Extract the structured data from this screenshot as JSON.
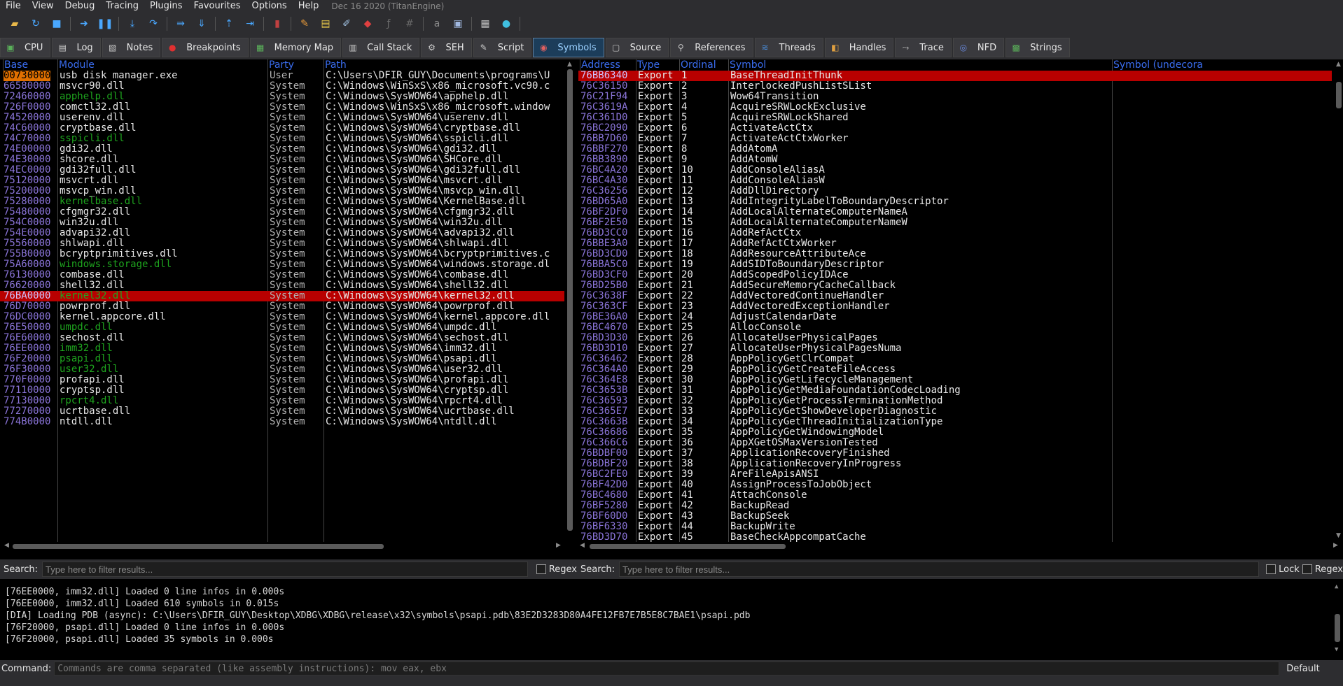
{
  "menu": {
    "items": [
      "File",
      "View",
      "Debug",
      "Tracing",
      "Plugins",
      "Favourites",
      "Options",
      "Help"
    ],
    "build_title": "Dec 16 2020 (TitanEngine)"
  },
  "tabs": [
    {
      "label": "CPU",
      "icon": "cpu-icon"
    },
    {
      "label": "Log",
      "icon": "log-icon"
    },
    {
      "label": "Notes",
      "icon": "notes-icon"
    },
    {
      "label": "Breakpoints",
      "icon": "breakpoint-icon"
    },
    {
      "label": "Memory Map",
      "icon": "memory-map-icon"
    },
    {
      "label": "Call Stack",
      "icon": "call-stack-icon"
    },
    {
      "label": "SEH",
      "icon": "seh-icon"
    },
    {
      "label": "Script",
      "icon": "script-icon"
    },
    {
      "label": "Symbols",
      "icon": "symbols-icon",
      "active": true
    },
    {
      "label": "Source",
      "icon": "source-icon"
    },
    {
      "label": "References",
      "icon": "references-icon"
    },
    {
      "label": "Threads",
      "icon": "threads-icon"
    },
    {
      "label": "Handles",
      "icon": "handles-icon"
    },
    {
      "label": "Trace",
      "icon": "trace-icon"
    },
    {
      "label": "NFD",
      "icon": "nfd-icon"
    },
    {
      "label": "Strings",
      "icon": "strings-icon"
    }
  ],
  "modules": {
    "headers": {
      "base": "Base",
      "module": "Module",
      "party": "Party",
      "path": "Path"
    },
    "rows": [
      {
        "base": "00730000",
        "module": "usb disk manager.exe",
        "party": "User",
        "path": "C:\\Users\\DFIR_GUY\\Documents\\programs\\U",
        "color": "white",
        "highlight_base": true
      },
      {
        "base": "66580000",
        "module": "msvcr90.dll",
        "party": "System",
        "path": "C:\\Windows\\WinSxS\\x86_microsoft.vc90.c",
        "color": "white"
      },
      {
        "base": "72460000",
        "module": "apphelp.dll",
        "party": "System",
        "path": "C:\\Windows\\SysWOW64\\apphelp.dll",
        "color": "green"
      },
      {
        "base": "726F0000",
        "module": "comctl32.dll",
        "party": "System",
        "path": "C:\\Windows\\WinSxS\\x86_microsoft.window",
        "color": "white"
      },
      {
        "base": "74520000",
        "module": "userenv.dll",
        "party": "System",
        "path": "C:\\Windows\\SysWOW64\\userenv.dll",
        "color": "white"
      },
      {
        "base": "74C60000",
        "module": "cryptbase.dll",
        "party": "System",
        "path": "C:\\Windows\\SysWOW64\\cryptbase.dll",
        "color": "white"
      },
      {
        "base": "74C70000",
        "module": "sspicli.dll",
        "party": "System",
        "path": "C:\\Windows\\SysWOW64\\sspicli.dll",
        "color": "green"
      },
      {
        "base": "74E00000",
        "module": "gdi32.dll",
        "party": "System",
        "path": "C:\\Windows\\SysWOW64\\gdi32.dll",
        "color": "white"
      },
      {
        "base": "74E30000",
        "module": "shcore.dll",
        "party": "System",
        "path": "C:\\Windows\\SysWOW64\\SHCore.dll",
        "color": "white"
      },
      {
        "base": "74EC0000",
        "module": "gdi32full.dll",
        "party": "System",
        "path": "C:\\Windows\\SysWOW64\\gdi32full.dll",
        "color": "white"
      },
      {
        "base": "75120000",
        "module": "msvcrt.dll",
        "party": "System",
        "path": "C:\\Windows\\SysWOW64\\msvcrt.dll",
        "color": "white"
      },
      {
        "base": "75200000",
        "module": "msvcp_win.dll",
        "party": "System",
        "path": "C:\\Windows\\SysWOW64\\msvcp_win.dll",
        "color": "white"
      },
      {
        "base": "75280000",
        "module": "kernelbase.dll",
        "party": "System",
        "path": "C:\\Windows\\SysWOW64\\KernelBase.dll",
        "color": "green"
      },
      {
        "base": "75480000",
        "module": "cfgmgr32.dll",
        "party": "System",
        "path": "C:\\Windows\\SysWOW64\\cfgmgr32.dll",
        "color": "white"
      },
      {
        "base": "754C0000",
        "module": "win32u.dll",
        "party": "System",
        "path": "C:\\Windows\\SysWOW64\\win32u.dll",
        "color": "white"
      },
      {
        "base": "754E0000",
        "module": "advapi32.dll",
        "party": "System",
        "path": "C:\\Windows\\SysWOW64\\advapi32.dll",
        "color": "white"
      },
      {
        "base": "75560000",
        "module": "shlwapi.dll",
        "party": "System",
        "path": "C:\\Windows\\SysWOW64\\shlwapi.dll",
        "color": "white"
      },
      {
        "base": "755B0000",
        "module": "bcryptprimitives.dll",
        "party": "System",
        "path": "C:\\Windows\\SysWOW64\\bcryptprimitives.c",
        "color": "white"
      },
      {
        "base": "75A60000",
        "module": "windows.storage.dll",
        "party": "System",
        "path": "C:\\Windows\\SysWOW64\\windows.storage.dl",
        "color": "green"
      },
      {
        "base": "76130000",
        "module": "combase.dll",
        "party": "System",
        "path": "C:\\Windows\\SysWOW64\\combase.dll",
        "color": "white"
      },
      {
        "base": "76620000",
        "module": "shell32.dll",
        "party": "System",
        "path": "C:\\Windows\\SysWOW64\\shell32.dll",
        "color": "white"
      },
      {
        "base": "76BA0000",
        "module": "kernel32.dll",
        "party": "System",
        "path": "C:\\Windows\\SysWOW64\\kernel32.dll",
        "color": "green",
        "selected": true
      },
      {
        "base": "76D70000",
        "module": "powrprof.dll",
        "party": "System",
        "path": "C:\\Windows\\SysWOW64\\powrprof.dll",
        "color": "white"
      },
      {
        "base": "76DC0000",
        "module": "kernel.appcore.dll",
        "party": "System",
        "path": "C:\\Windows\\SysWOW64\\kernel.appcore.dll",
        "color": "white"
      },
      {
        "base": "76E50000",
        "module": "umpdc.dll",
        "party": "System",
        "path": "C:\\Windows\\SysWOW64\\umpdc.dll",
        "color": "green"
      },
      {
        "base": "76E60000",
        "module": "sechost.dll",
        "party": "System",
        "path": "C:\\Windows\\SysWOW64\\sechost.dll",
        "color": "white"
      },
      {
        "base": "76EE0000",
        "module": "imm32.dll",
        "party": "System",
        "path": "C:\\Windows\\SysWOW64\\imm32.dll",
        "color": "green"
      },
      {
        "base": "76F20000",
        "module": "psapi.dll",
        "party": "System",
        "path": "C:\\Windows\\SysWOW64\\psapi.dll",
        "color": "green"
      },
      {
        "base": "76F30000",
        "module": "user32.dll",
        "party": "System",
        "path": "C:\\Windows\\SysWOW64\\user32.dll",
        "color": "green"
      },
      {
        "base": "770F0000",
        "module": "profapi.dll",
        "party": "System",
        "path": "C:\\Windows\\SysWOW64\\profapi.dll",
        "color": "white"
      },
      {
        "base": "77110000",
        "module": "cryptsp.dll",
        "party": "System",
        "path": "C:\\Windows\\SysWOW64\\cryptsp.dll",
        "color": "white"
      },
      {
        "base": "77130000",
        "module": "rpcrt4.dll",
        "party": "System",
        "path": "C:\\Windows\\SysWOW64\\rpcrt4.dll",
        "color": "green"
      },
      {
        "base": "77270000",
        "module": "ucrtbase.dll",
        "party": "System",
        "path": "C:\\Windows\\SysWOW64\\ucrtbase.dll",
        "color": "white"
      },
      {
        "base": "774B0000",
        "module": "ntdll.dll",
        "party": "System",
        "path": "C:\\Windows\\SysWOW64\\ntdll.dll",
        "color": "white"
      }
    ]
  },
  "symbols": {
    "headers": {
      "address": "Address",
      "type": "Type",
      "ordinal": "Ordinal",
      "symbol": "Symbol",
      "undecorated": "Symbol (undecora"
    },
    "rows": [
      {
        "address": "76BB6340",
        "type": "Export",
        "ordinal": "1",
        "symbol": "BaseThreadInitThunk",
        "selected": true
      },
      {
        "address": "76C36150",
        "type": "Export",
        "ordinal": "2",
        "symbol": "InterlockedPushListSList"
      },
      {
        "address": "76C21F94",
        "type": "Export",
        "ordinal": "3",
        "symbol": "Wow64Transition"
      },
      {
        "address": "76C3619A",
        "type": "Export",
        "ordinal": "4",
        "symbol": "AcquireSRWLockExclusive"
      },
      {
        "address": "76C361D0",
        "type": "Export",
        "ordinal": "5",
        "symbol": "AcquireSRWLockShared"
      },
      {
        "address": "76BC2090",
        "type": "Export",
        "ordinal": "6",
        "symbol": "ActivateActCtx"
      },
      {
        "address": "76BB7D60",
        "type": "Export",
        "ordinal": "7",
        "symbol": "ActivateActCtxWorker"
      },
      {
        "address": "76BBF270",
        "type": "Export",
        "ordinal": "8",
        "symbol": "AddAtomA"
      },
      {
        "address": "76BB3890",
        "type": "Export",
        "ordinal": "9",
        "symbol": "AddAtomW"
      },
      {
        "address": "76BC4A20",
        "type": "Export",
        "ordinal": "10",
        "symbol": "AddConsoleAliasA"
      },
      {
        "address": "76BC4A30",
        "type": "Export",
        "ordinal": "11",
        "symbol": "AddConsoleAliasW"
      },
      {
        "address": "76C36256",
        "type": "Export",
        "ordinal": "12",
        "symbol": "AddDllDirectory"
      },
      {
        "address": "76BD65A0",
        "type": "Export",
        "ordinal": "13",
        "symbol": "AddIntegrityLabelToBoundaryDescriptor"
      },
      {
        "address": "76BF2DF0",
        "type": "Export",
        "ordinal": "14",
        "symbol": "AddLocalAlternateComputerNameA"
      },
      {
        "address": "76BF2E50",
        "type": "Export",
        "ordinal": "15",
        "symbol": "AddLocalAlternateComputerNameW"
      },
      {
        "address": "76BD3CC0",
        "type": "Export",
        "ordinal": "16",
        "symbol": "AddRefActCtx"
      },
      {
        "address": "76BBE3A0",
        "type": "Export",
        "ordinal": "17",
        "symbol": "AddRefActCtxWorker"
      },
      {
        "address": "76BD3CD0",
        "type": "Export",
        "ordinal": "18",
        "symbol": "AddResourceAttributeAce"
      },
      {
        "address": "76BBA5C0",
        "type": "Export",
        "ordinal": "19",
        "symbol": "AddSIDToBoundaryDescriptor"
      },
      {
        "address": "76BD3CF0",
        "type": "Export",
        "ordinal": "20",
        "symbol": "AddScopedPolicyIDAce"
      },
      {
        "address": "76BD25B0",
        "type": "Export",
        "ordinal": "21",
        "symbol": "AddSecureMemoryCacheCallback"
      },
      {
        "address": "76C3638F",
        "type": "Export",
        "ordinal": "22",
        "symbol": "AddVectoredContinueHandler"
      },
      {
        "address": "76C363CF",
        "type": "Export",
        "ordinal": "23",
        "symbol": "AddVectoredExceptionHandler"
      },
      {
        "address": "76BE36A0",
        "type": "Export",
        "ordinal": "24",
        "symbol": "AdjustCalendarDate"
      },
      {
        "address": "76BC4670",
        "type": "Export",
        "ordinal": "25",
        "symbol": "AllocConsole"
      },
      {
        "address": "76BD3D30",
        "type": "Export",
        "ordinal": "26",
        "symbol": "AllocateUserPhysicalPages"
      },
      {
        "address": "76BD3D10",
        "type": "Export",
        "ordinal": "27",
        "symbol": "AllocateUserPhysicalPagesNuma"
      },
      {
        "address": "76C36462",
        "type": "Export",
        "ordinal": "28",
        "symbol": "AppPolicyGetClrCompat"
      },
      {
        "address": "76C364A0",
        "type": "Export",
        "ordinal": "29",
        "symbol": "AppPolicyGetCreateFileAccess"
      },
      {
        "address": "76C364E8",
        "type": "Export",
        "ordinal": "30",
        "symbol": "AppPolicyGetLifecycleManagement"
      },
      {
        "address": "76C3653B",
        "type": "Export",
        "ordinal": "31",
        "symbol": "AppPolicyGetMediaFoundationCodecLoading"
      },
      {
        "address": "76C36593",
        "type": "Export",
        "ordinal": "32",
        "symbol": "AppPolicyGetProcessTerminationMethod"
      },
      {
        "address": "76C365E7",
        "type": "Export",
        "ordinal": "33",
        "symbol": "AppPolicyGetShowDeveloperDiagnostic"
      },
      {
        "address": "76C3663B",
        "type": "Export",
        "ordinal": "34",
        "symbol": "AppPolicyGetThreadInitializationType"
      },
      {
        "address": "76C36686",
        "type": "Export",
        "ordinal": "35",
        "symbol": "AppPolicyGetWindowingModel"
      },
      {
        "address": "76C366C6",
        "type": "Export",
        "ordinal": "36",
        "symbol": "AppXGetOSMaxVersionTested"
      },
      {
        "address": "76BDBF00",
        "type": "Export",
        "ordinal": "37",
        "symbol": "ApplicationRecoveryFinished"
      },
      {
        "address": "76BDBF20",
        "type": "Export",
        "ordinal": "38",
        "symbol": "ApplicationRecoveryInProgress"
      },
      {
        "address": "76BC2FE0",
        "type": "Export",
        "ordinal": "39",
        "symbol": "AreFileApisANSI"
      },
      {
        "address": "76BF42D0",
        "type": "Export",
        "ordinal": "40",
        "symbol": "AssignProcessToJobObject"
      },
      {
        "address": "76BC4680",
        "type": "Export",
        "ordinal": "41",
        "symbol": "AttachConsole"
      },
      {
        "address": "76BF5280",
        "type": "Export",
        "ordinal": "42",
        "symbol": "BackupRead"
      },
      {
        "address": "76BF60D0",
        "type": "Export",
        "ordinal": "43",
        "symbol": "BackupSeek"
      },
      {
        "address": "76BF6330",
        "type": "Export",
        "ordinal": "44",
        "symbol": "BackupWrite"
      },
      {
        "address": "76BD3D70",
        "type": "Export",
        "ordinal": "45",
        "symbol": "BaseCheckAppcompatCache"
      }
    ]
  },
  "search_left": {
    "label": "Search:",
    "placeholder": "Type here to filter results...",
    "regex_label": "Regex"
  },
  "search_right": {
    "label": "Search:",
    "placeholder": "Type here to filter results...",
    "lock_label": "Lock",
    "regex_label": "Regex"
  },
  "log": [
    "[76EE0000, imm32.dll] Loaded 0 line infos in 0.000s",
    "[76EE0000, imm32.dll] Loaded 610 symbols in 0.015s",
    "[DIA] Loading PDB (async): C:\\Users\\DFIR_GUY\\Desktop\\XDBG\\XDBG\\release\\x32\\symbols\\psapi.pdb\\83E2D3283D80A4FE12FB7E7B5E8C7BAE1\\psapi.pdb",
    "[76F20000, psapi.dll] Loaded 0 line infos in 0.000s",
    "[76F20000, psapi.dll] Loaded 35 symbols in 0.000s"
  ],
  "command": {
    "label": "Command:",
    "placeholder": "Commands are comma separated (like assembly instructions): mov eax, ebx",
    "mode": "Default"
  },
  "colors": {
    "selected_row": "#b80000",
    "header_blue": "#3a6df0",
    "address_purple": "#8a74d8",
    "system_module_green": "#1ea51e",
    "base_highlight": "#e07000"
  }
}
